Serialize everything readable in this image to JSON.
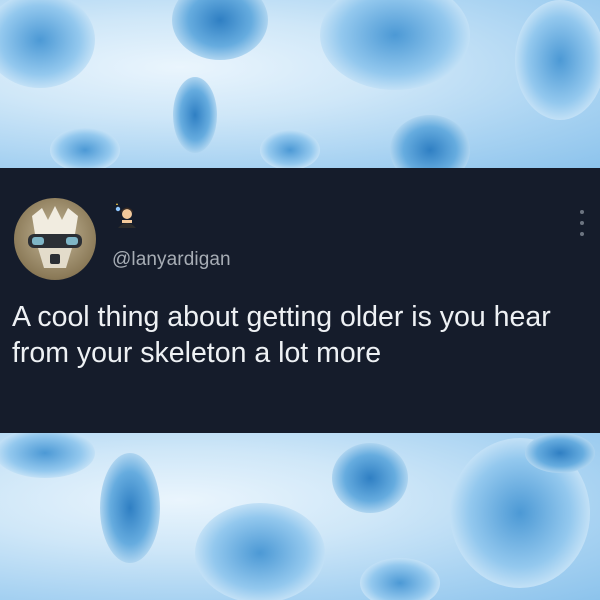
{
  "tweet": {
    "author_handle": "@lanyardigan",
    "author_display_name_icon": "person-emoji-icon",
    "text": "A cool thing about getting older is you hear from your skeleton a lot more",
    "more_options_icon": "vertical-ellipsis-icon"
  },
  "background": {
    "description_icon": "bone-texture-background",
    "colors": {
      "light": "#eaf5fd",
      "mid": "#a9d3f2",
      "dark": "#3f8fce"
    }
  },
  "colors": {
    "card_background": "#151c2b",
    "text": "#eef1f4",
    "handle": "#a7adb5"
  }
}
